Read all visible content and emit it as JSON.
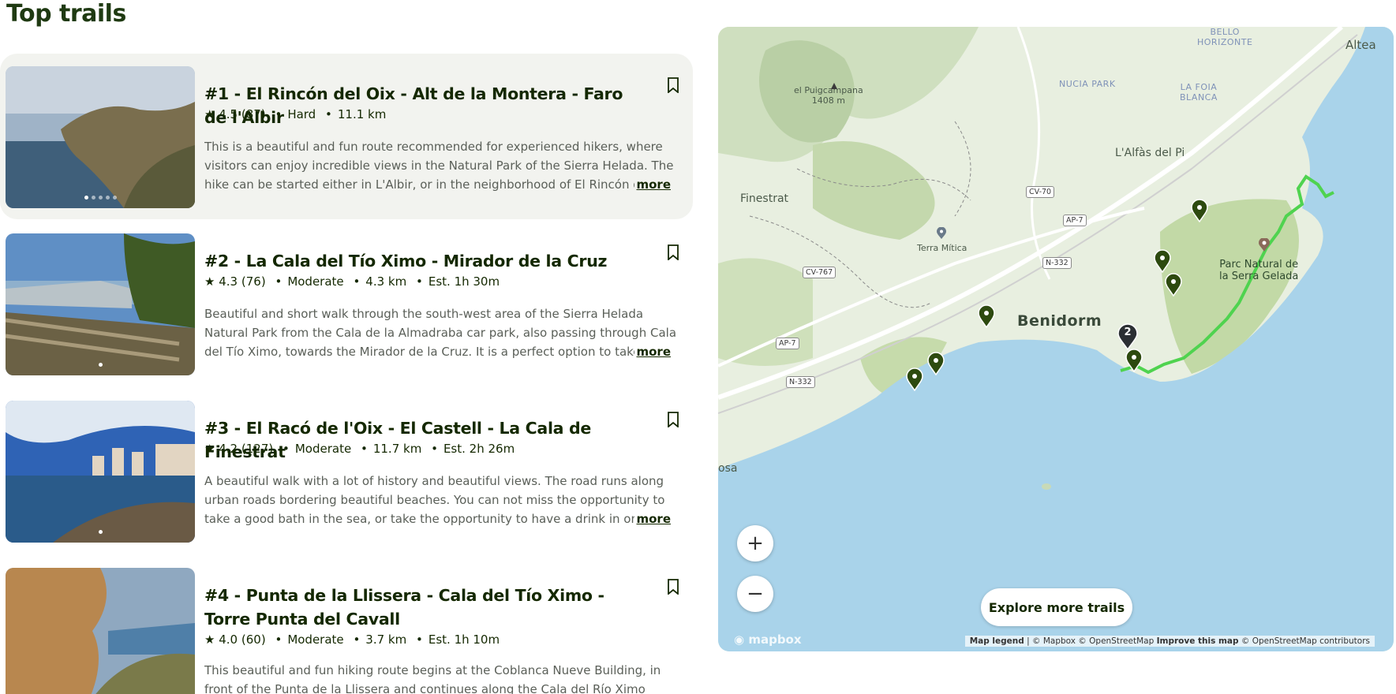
{
  "page": {
    "title": "Top trails"
  },
  "trails": [
    {
      "title": "#1 - El Rincón del Oix - Alt de la Montera - Faro de l'Albir",
      "rating": "4.5",
      "reviews": "(87)",
      "difficulty": "Hard",
      "distance": "11.1 km",
      "est": "",
      "description": "This is a beautiful and fun route recommended for experienced hikers, where visitors can enjoy incredible views in the Natural Park of the Sierra Helada. The hike can be started either in L'Albir, or in the neighborhood of El Rincón del ...",
      "more": "more"
    },
    {
      "title": "#2 - La Cala del Tío Ximo - Mirador de la Cruz",
      "rating": "4.3",
      "reviews": "(76)",
      "difficulty": "Moderate",
      "distance": "4.3 km",
      "est": "Est. 1h 30m",
      "description": "Beautiful and short walk through the south-west area of the Sierra Helada Natural Park from the Cala de la Almadraba car park, also passing through Cala del Tío Ximo, towards the Mirador de la Cruz. It is a perfect option to take a...",
      "more": "more"
    },
    {
      "title": "#3 - El Racó de l'Oix - El Castell - La Cala de Finestrat",
      "rating": "4.2",
      "reviews": "(127)",
      "difficulty": "Moderate",
      "distance": "11.7 km",
      "est": "Est. 2h 26m",
      "description": "A beautiful walk with a lot of history and beautiful views. The road runs along urban roads bordering beautiful beaches. You can not miss the opportunity to take a good bath in the sea, or take the opportunity to have a drink in one o...",
      "more": "more"
    },
    {
      "title": "#4 - Punta de la Llissera - Cala del Tío Ximo - Torre Punta del Cavall",
      "rating": "4.0",
      "reviews": "(60)",
      "difficulty": "Moderate",
      "distance": "3.7 km",
      "est": "Est. 1h 10m",
      "description": "This beautiful and fun hiking route begins at the Coblanca Nueve Building, in front of the Punta de la Llissera and continues along the Cala del Río Ximo",
      "more": ""
    }
  ],
  "map": {
    "labels": {
      "puig": "el Puigcampana",
      "puig_elev": "1408 m",
      "bello1": "BELLO",
      "bello2": "HORIZONTE",
      "altea": "Altea",
      "nucia": "NUCIA PARK",
      "foia1": "LA FOIA",
      "foia2": "BLANCA",
      "alfas": "L'Alfàs del Pi",
      "finestrat": "Finestrat",
      "terra": "Terra Mítica",
      "benidorm": "Benidorm",
      "park1": "Parc Natural de",
      "park2": "la Serra Gelada",
      "osa": "osa"
    },
    "roads": {
      "cv70": "CV-70",
      "ap7a": "AP-7",
      "n332a": "N-332",
      "cv767": "CV-767",
      "ap7b": "AP-7",
      "n332b": "N-332"
    },
    "cluster_count": "2",
    "zoom_in": "+",
    "zoom_out": "−",
    "explore": "Explore more trails",
    "logo": "mapbox",
    "attribution": {
      "legend": "Map legend",
      "sep": "|",
      "mapbox": "© Mapbox © OpenStreetMap",
      "improve": "Improve this map",
      "osm": "© OpenStreetMap contributors"
    },
    "colors": {
      "water": "#a9d3ea",
      "land": "#e8efe0",
      "green": "#c9deb0",
      "pin": "#2d4a0f",
      "route": "#5fd35f"
    }
  }
}
